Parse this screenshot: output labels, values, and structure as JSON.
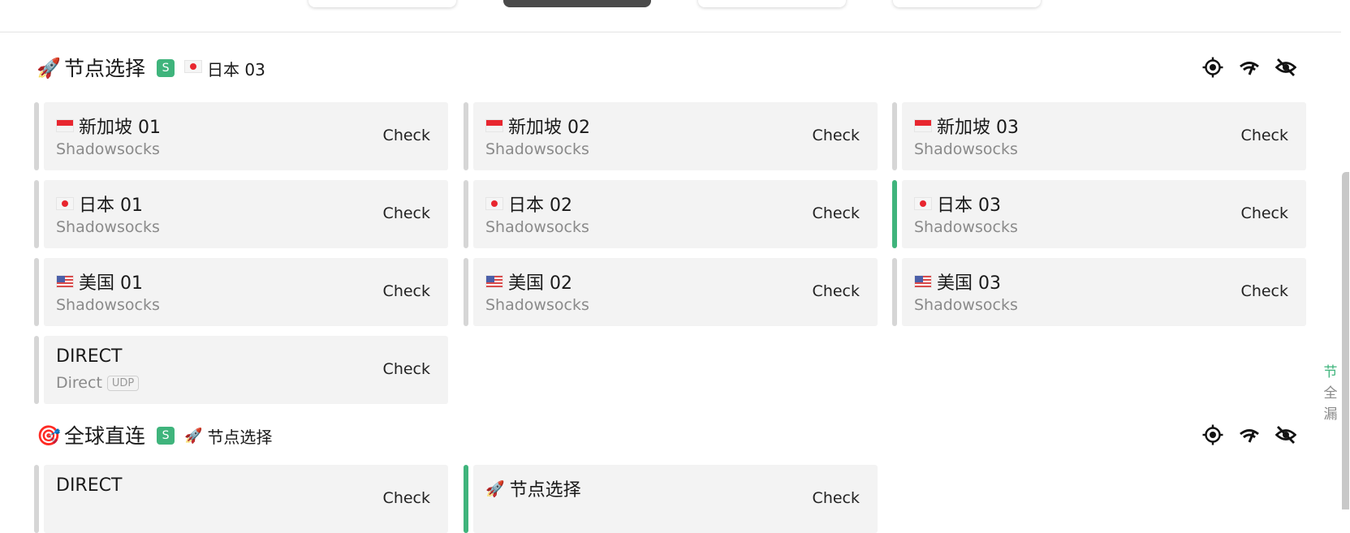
{
  "groups": [
    {
      "icon": "rocket-emoji",
      "icon_glyph": "🚀",
      "title": "节点选择",
      "badge": "S",
      "current_icon": "jp-flag",
      "current": "日本 03",
      "actions": [
        "locate-icon",
        "speed-test-icon",
        "eye-off-icon"
      ],
      "nodes": [
        {
          "flag": "sg",
          "name": "新加坡 01",
          "type": "Shadowsocks",
          "udp": "",
          "check": "Check",
          "selected": false
        },
        {
          "flag": "sg",
          "name": "新加坡 02",
          "type": "Shadowsocks",
          "udp": "",
          "check": "Check",
          "selected": false
        },
        {
          "flag": "sg",
          "name": "新加坡 03",
          "type": "Shadowsocks",
          "udp": "",
          "check": "Check",
          "selected": false
        },
        {
          "flag": "jp",
          "name": "日本 01",
          "type": "Shadowsocks",
          "udp": "",
          "check": "Check",
          "selected": false
        },
        {
          "flag": "jp",
          "name": "日本 02",
          "type": "Shadowsocks",
          "udp": "",
          "check": "Check",
          "selected": false
        },
        {
          "flag": "jp",
          "name": "日本 03",
          "type": "Shadowsocks",
          "udp": "",
          "check": "Check",
          "selected": true
        },
        {
          "flag": "us",
          "name": "美国 01",
          "type": "Shadowsocks",
          "udp": "",
          "check": "Check",
          "selected": false
        },
        {
          "flag": "us",
          "name": "美国 02",
          "type": "Shadowsocks",
          "udp": "",
          "check": "Check",
          "selected": false
        },
        {
          "flag": "us",
          "name": "美国 03",
          "type": "Shadowsocks",
          "udp": "",
          "check": "Check",
          "selected": false
        },
        {
          "flag": "",
          "name": "DIRECT",
          "type": "Direct",
          "udp": "UDP",
          "check": "Check",
          "selected": false
        }
      ]
    },
    {
      "icon": "target-emoji",
      "icon_glyph": "🎯",
      "title": "全球直连",
      "badge": "S",
      "current_icon": "rocket-emoji",
      "current_glyph": "🚀",
      "current": "节点选择",
      "actions": [
        "locate-icon",
        "speed-test-icon",
        "eye-off-icon"
      ],
      "nodes": [
        {
          "flag": "",
          "name": "DIRECT",
          "type": "",
          "udp": "",
          "check": "Check",
          "selected": false
        },
        {
          "flag": "rocket",
          "name": "节点选择",
          "type": "",
          "udp": "",
          "check": "Check",
          "selected": true
        }
      ]
    }
  ],
  "side_index": [
    {
      "label": "节",
      "active": true
    },
    {
      "label": "全",
      "active": false
    },
    {
      "label": "漏",
      "active": false
    }
  ],
  "colors": {
    "accent": "#3fb47c",
    "card_bg": "#f3f3f3",
    "bar_idle": "#d6d6d6",
    "text_secondary": "#8a8a8a"
  }
}
